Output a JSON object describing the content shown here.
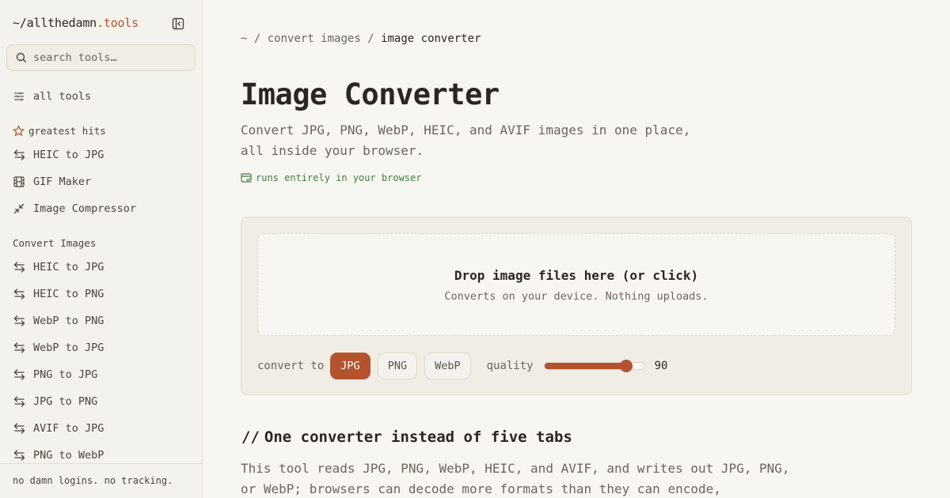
{
  "brand": {
    "prefix": "~/",
    "name": "allthedamn",
    "suffix": ".tools"
  },
  "search": {
    "placeholder": "search tools…"
  },
  "nav": {
    "all_tools": "all tools",
    "greatest_hits_label": "greatest hits",
    "greatest_hits": [
      {
        "label": "HEIC to JPG",
        "icon": "arrows-swap-icon"
      },
      {
        "label": "GIF Maker",
        "icon": "film-icon"
      },
      {
        "label": "Image Compressor",
        "icon": "compress-icon"
      }
    ],
    "convert_images_label": "Convert Images",
    "convert_images": [
      {
        "label": "HEIC to JPG",
        "icon": "arrows-swap-icon"
      },
      {
        "label": "HEIC to PNG",
        "icon": "arrows-swap-icon"
      },
      {
        "label": "WebP to PNG",
        "icon": "arrows-swap-icon"
      },
      {
        "label": "WebP to JPG",
        "icon": "arrows-swap-icon"
      },
      {
        "label": "PNG to JPG",
        "icon": "arrows-swap-icon"
      },
      {
        "label": "JPG to PNG",
        "icon": "arrows-swap-icon"
      },
      {
        "label": "AVIF to JPG",
        "icon": "arrows-swap-icon"
      },
      {
        "label": "PNG to WebP",
        "icon": "arrows-swap-icon"
      }
    ],
    "footer": "no damn logins. no tracking."
  },
  "breadcrumb": {
    "root": "~",
    "sep": "/",
    "parent": "convert images",
    "current": "image converter"
  },
  "page": {
    "title": "Image Converter",
    "subtitle": "Convert JPG, PNG, WebP, HEIC, and AVIF images in one place, all inside your browser.",
    "badge": "runs entirely in your browser"
  },
  "dropzone": {
    "title": "Drop image files here (or click)",
    "subtitle": "Converts on your device. Nothing uploads."
  },
  "controls": {
    "convert_to_label": "convert to",
    "formats": [
      "JPG",
      "PNG",
      "WebP"
    ],
    "selected_format": "JPG",
    "quality_label": "quality",
    "quality_value": "90",
    "quality_fraction": 0.82
  },
  "section": {
    "slashes": "//",
    "heading": "One converter instead of five tabs",
    "body": "This tool reads JPG, PNG, WebP, HEIC, and AVIF, and writes out JPG, PNG, or WebP; browsers can decode more formats than they can encode,"
  },
  "colors": {
    "accent": "#b5532e",
    "success": "#3f7d45",
    "background": "#f8f6f1"
  }
}
